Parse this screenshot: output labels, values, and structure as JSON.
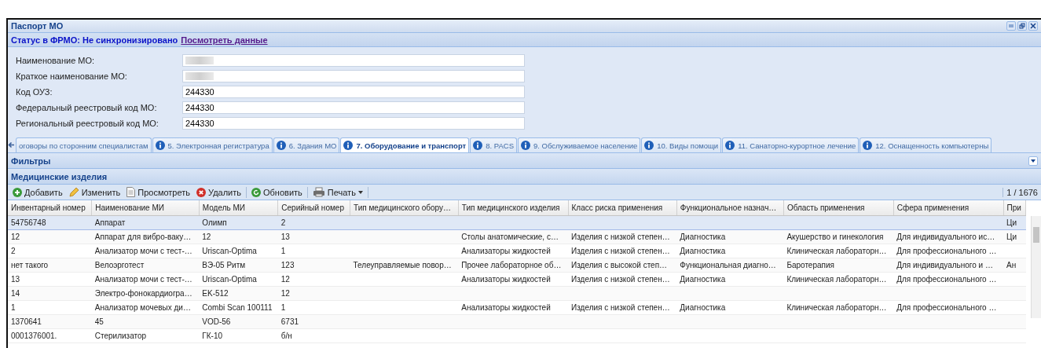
{
  "window": {
    "title": "Паспорт МО"
  },
  "status": {
    "label": "Статус в ФРМО: Не синхронизировано",
    "link": "Посмотреть данные"
  },
  "fields": [
    {
      "label": "Наименование МО:",
      "redacted": true
    },
    {
      "label": "Краткое наименование МО:",
      "redacted": true
    },
    {
      "label": "Код ОУЗ:",
      "value": "244330",
      "redacted": false
    },
    {
      "label": "Федеральный реестровый код МО:",
      "value": "244330",
      "redacted": false
    },
    {
      "label": "Региональный реестровый код МО:",
      "value": "244330",
      "redacted": false
    }
  ],
  "tabs": [
    {
      "label": "оговоры по сторонним специалистам",
      "selected": false,
      "info": false
    },
    {
      "label": "5. Электронная регистратура",
      "selected": false,
      "info": true
    },
    {
      "label": "6. Здания МО",
      "selected": false,
      "info": true
    },
    {
      "label": "7. Оборудование и транспорт",
      "selected": true,
      "info": true
    },
    {
      "label": "8. PACS",
      "selected": false,
      "info": true
    },
    {
      "label": "9. Обслуживаемое население",
      "selected": false,
      "info": true
    },
    {
      "label": "10. Виды помощи",
      "selected": false,
      "info": true
    },
    {
      "label": "11. Санаторно-курортное лечение",
      "selected": false,
      "info": true
    },
    {
      "label": "12. Оснащенность компьютерны",
      "selected": false,
      "info": true
    }
  ],
  "filters": {
    "title": "Фильтры",
    "expanded": false
  },
  "grid": {
    "title": "Медицинские изделия",
    "toolbar": [
      {
        "kind": "add",
        "label": "Добавить"
      },
      {
        "kind": "edit",
        "label": "Изменить"
      },
      {
        "kind": "view",
        "label": "Просмотреть"
      },
      {
        "kind": "delete",
        "label": "Удалить"
      },
      {
        "kind": "refresh",
        "label": "Обновить"
      },
      {
        "kind": "print",
        "label": "Печать"
      }
    ],
    "pager": "1 / 1676",
    "columns": [
      "Инвентарный номер",
      "Наименование МИ",
      "Модель МИ",
      "Серийный номер",
      "Тип медицинского обору…",
      "Тип медицинского изделия",
      "Класс риска применения",
      "Функциональное назнач…",
      "Область применения",
      "Сфера применения",
      "При"
    ],
    "rows": [
      {
        "selected": true,
        "cells": [
          "54756748",
          "Аппарат",
          "Олимп",
          "2",
          null,
          null,
          null,
          null,
          null,
          null,
          "Ци"
        ]
      },
      {
        "selected": false,
        "cells": [
          "12",
          "Аппарат для вибро-ваку…",
          "12",
          "13",
          null,
          "Столы анатомические, с…",
          "Изделия с низкой степен…",
          "Диагностика",
          "Акушерство и гинекология",
          "Для индивидуального ис…",
          "Ци"
        ]
      },
      {
        "selected": false,
        "cells": [
          "2",
          "Анализатор мочи с тест-…",
          "Uriscan-Optima",
          "1",
          null,
          "Анализаторы жидкостей",
          "Изделия с низкой степен…",
          "Диагностика",
          "Клиническая лабораторн…",
          "Для профессионального …",
          null
        ]
      },
      {
        "selected": false,
        "cells": [
          "нет такого",
          "Велоэрготест",
          "ВЭ-05 Ритм",
          "123",
          "Телеуправляемые повор…",
          "Прочее лабораторное об…",
          "Изделия с высокой степ…",
          "Функциональная диагно…",
          "Баротерапия",
          "Для индивидуального и …",
          "Ан"
        ]
      },
      {
        "selected": false,
        "cells": [
          "13",
          "Анализатор мочи с тест-…",
          "Uriscan-Optima",
          "12",
          null,
          "Анализаторы жидкостей",
          "Изделия с низкой степен…",
          "Диагностика",
          "Клиническая лабораторн…",
          "Для профессионального …",
          null
        ]
      },
      {
        "selected": false,
        "cells": [
          "14",
          "Электро-фонокардиогра…",
          "EK-512",
          "12",
          null,
          null,
          null,
          null,
          null,
          null,
          null
        ]
      },
      {
        "selected": false,
        "cells": [
          "1",
          "Анализатор мочевых ди…",
          "Combi Scan 100111",
          "1",
          null,
          "Анализаторы жидкостей",
          "Изделия с низкой степен…",
          "Диагностика",
          "Клиническая лабораторн…",
          "Для профессионального …",
          null
        ]
      },
      {
        "selected": false,
        "cells": [
          "1370641",
          "45",
          "VOD-56",
          "6731",
          null,
          null,
          null,
          null,
          null,
          null,
          null
        ]
      },
      {
        "selected": false,
        "cells": [
          "0001376001.",
          "Стерилизатор",
          "ГК-10",
          "б/н",
          null,
          null,
          null,
          null,
          null,
          null,
          null
        ]
      }
    ]
  }
}
